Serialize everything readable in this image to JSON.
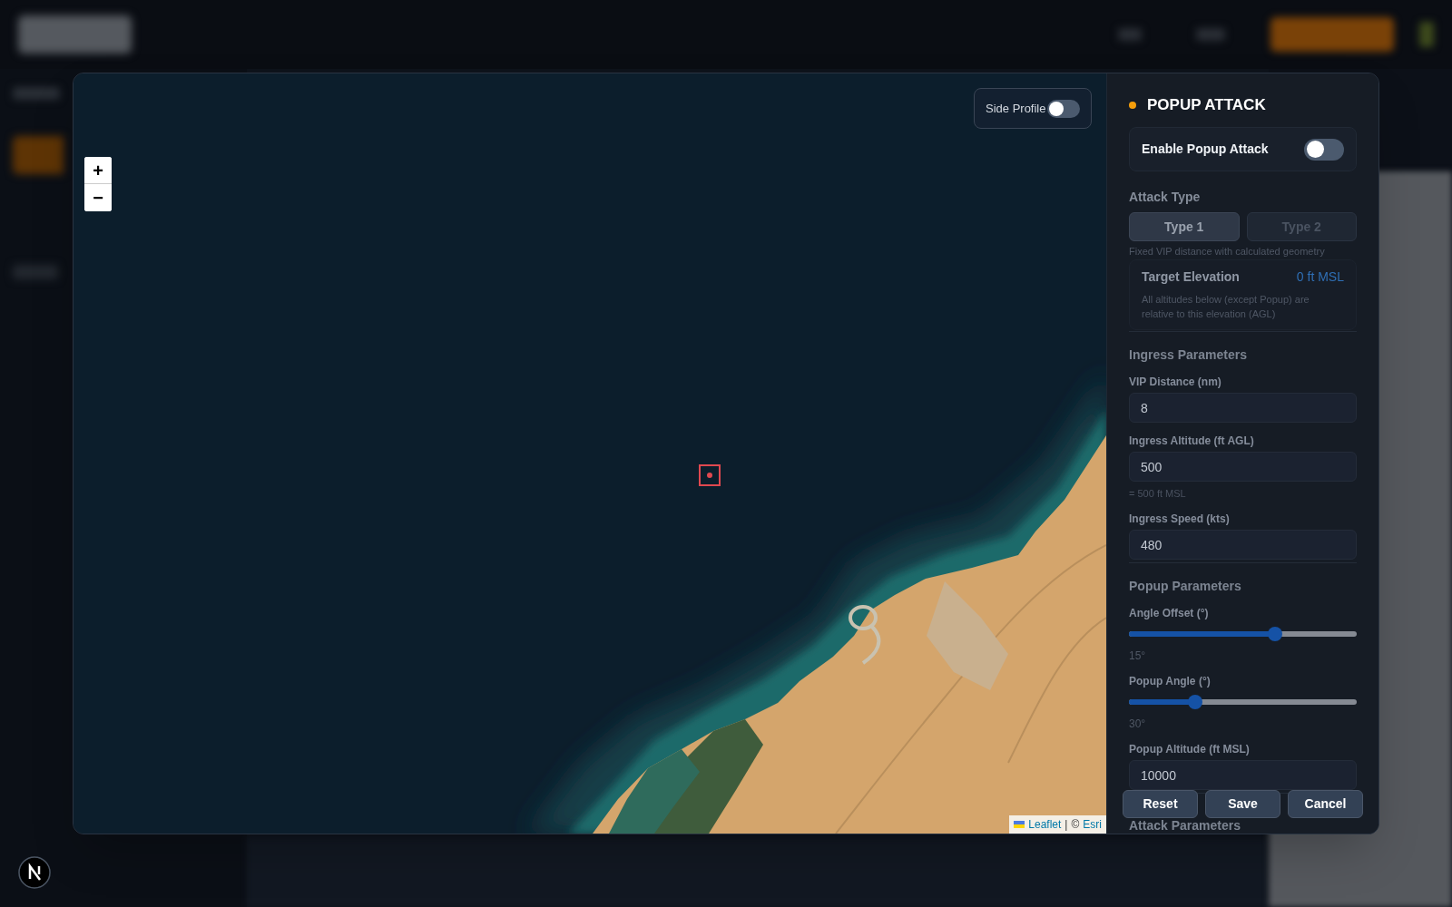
{
  "map": {
    "side_profile": {
      "label": "Side Profile",
      "on": false
    },
    "zoom_controls": [
      "+",
      "−"
    ],
    "attribution": {
      "library": "Leaflet",
      "separator": "|",
      "copyright": "©",
      "provider": "Esri"
    }
  },
  "panel": {
    "title": "POPUP ATTACK",
    "enable": {
      "label": "Enable Popup Attack",
      "on": false
    },
    "attack_type": {
      "label": "Attack Type",
      "options": [
        {
          "label": "Type 1",
          "selected": true
        },
        {
          "label": "Type 2",
          "selected": false
        }
      ],
      "description": "Fixed VIP distance with calculated geometry"
    },
    "target_elevation": {
      "label": "Target Elevation",
      "value": "0 ft MSL",
      "note": "All altitudes below (except Popup) are relative to this elevation (AGL)"
    },
    "sections": [
      {
        "title": "Ingress Parameters",
        "fields": [
          {
            "kind": "input",
            "label": "VIP Distance (nm)",
            "value": "8"
          },
          {
            "kind": "input",
            "label": "Ingress Altitude (ft AGL)",
            "value": "500",
            "note": "= 500 ft MSL"
          },
          {
            "kind": "input",
            "label": "Ingress Speed (kts)",
            "value": "480"
          }
        ]
      },
      {
        "title": "Popup Parameters",
        "fields": [
          {
            "kind": "slider",
            "label": "Angle Offset (°)",
            "level": 0.64,
            "reading": "15°"
          },
          {
            "kind": "slider",
            "label": "Popup Angle (°)",
            "level": 0.29,
            "reading": "30°"
          },
          {
            "kind": "input",
            "label": "Popup Altitude (ft MSL)",
            "value": "10000"
          }
        ]
      },
      {
        "title": "Attack Parameters"
      }
    ]
  },
  "footer": {
    "buttons": [
      "Reset",
      "Save",
      "Cancel"
    ]
  }
}
